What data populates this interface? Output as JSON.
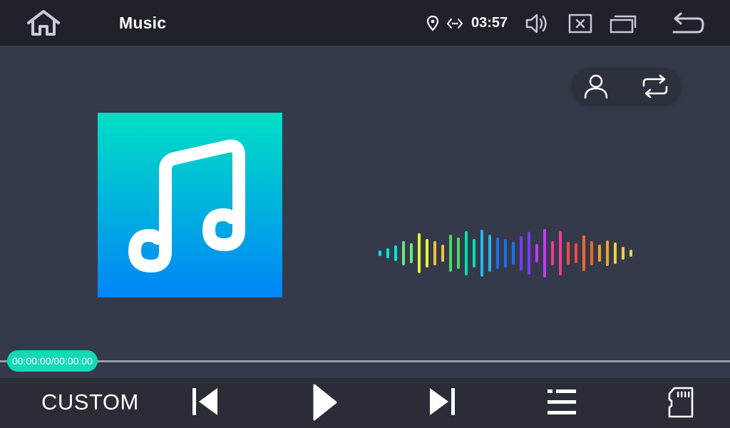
{
  "header": {
    "title": "Music",
    "time": "03:57"
  },
  "player": {
    "time_display": "00:00:00/00:00:00",
    "progress": 0
  },
  "controls": {
    "eq_preset": "CUSTOM"
  },
  "icons": {
    "home": "home-icon",
    "location": "location-pin-icon",
    "link": "link-icon",
    "volume": "volume-icon",
    "close_app": "close-app-icon",
    "recent_apps": "recent-apps-icon",
    "back": "back-icon",
    "artist": "artist-icon",
    "repeat": "repeat-icon",
    "album_art": "music-note-icon",
    "previous": "skip-previous-icon",
    "play": "play-icon",
    "next": "skip-next-icon",
    "playlist": "playlist-icon",
    "source": "sd-card-icon"
  },
  "colors": {
    "accent": "#14d9b5",
    "top_bar": "#1f2229",
    "background": "#353a4a",
    "bottom_bar": "#2a2d36",
    "album_gradient": [
      "#00dfc4",
      "#0085f8"
    ],
    "visualizer": [
      "#00e5e0",
      "#66e87a",
      "#e4f53a",
      "#f0c33a",
      "#4cd96a",
      "#00e0b0",
      "#2ab4e8",
      "#1f6fe8",
      "#7a3cf0",
      "#c43cf0",
      "#f03c9a",
      "#f04a4a",
      "#f06a2a",
      "#f0a02a",
      "#f0d23a"
    ]
  }
}
